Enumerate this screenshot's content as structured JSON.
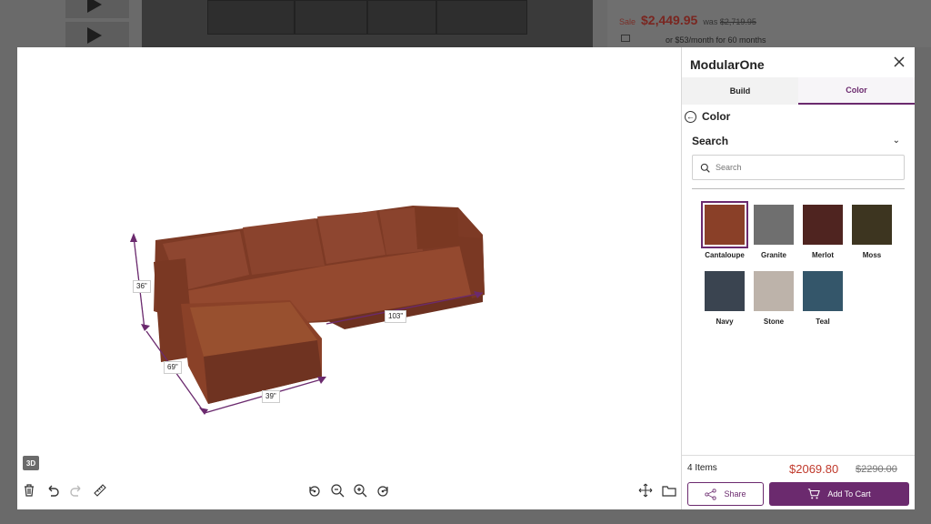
{
  "background": {
    "sale_label": "Sale",
    "sale_price": "$2,449.95",
    "was_label": "was",
    "was_price": "$2,719.95",
    "monthly": "or $53/month for 60 months"
  },
  "viewer": {
    "badge_3d": "3D",
    "dimensions": {
      "height": "36\"",
      "depth": "69\"",
      "chaise_width": "39\"",
      "length": "103\""
    },
    "left_tools": [
      "trash-icon",
      "undo-icon",
      "redo-icon",
      "ruler-icon"
    ],
    "center_tools": [
      "rotate-left-icon",
      "zoom-out-icon",
      "zoom-in-icon",
      "rotate-right-icon"
    ],
    "right_tools": [
      "move-icon",
      "folder-icon"
    ]
  },
  "panel": {
    "title": "ModularOne",
    "tabs": [
      {
        "label": "Build"
      },
      {
        "label": "Color"
      }
    ],
    "active_tab": "Color",
    "section_title": "Color",
    "search_heading": "Search",
    "search_placeholder": "Search",
    "swatches": [
      {
        "name": "Cantaloupe",
        "color": "#8a4028",
        "selected": true
      },
      {
        "name": "Granite",
        "color": "#6f6f6f"
      },
      {
        "name": "Merlot",
        "color": "#4f2420"
      },
      {
        "name": "Moss",
        "color": "#3d3520"
      },
      {
        "name": "Navy",
        "color": "#3a4450"
      },
      {
        "name": "Stone",
        "color": "#bdb3aa"
      },
      {
        "name": "Teal",
        "color": "#34566a"
      }
    ],
    "footer": {
      "items": "4 Items",
      "price": "$2069.80",
      "was_price": "$2290.00",
      "share_label": "Share",
      "cart_label": "Add To Cart"
    }
  },
  "colors": {
    "accent": "#6b2a6e",
    "price_red": "#c0392b",
    "sofa": "#8a4028"
  }
}
